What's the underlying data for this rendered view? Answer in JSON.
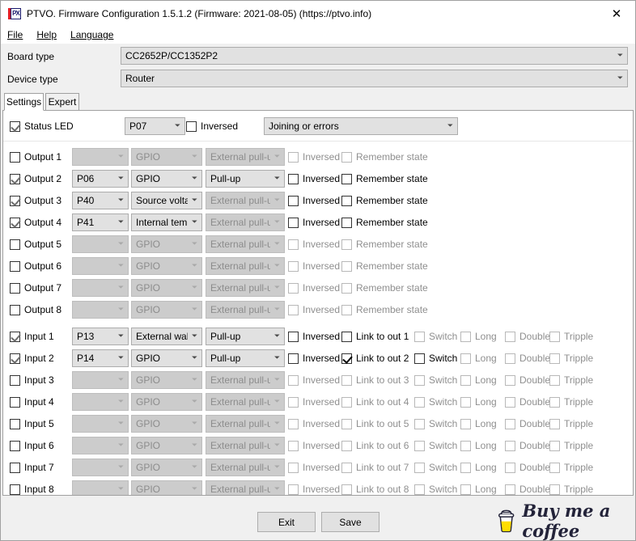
{
  "window": {
    "title": "PTVO. Firmware Configuration 1.5.1.2 (Firmware: 2021-08-05) (https://ptvo.info)",
    "icon": "ptvo-app-icon",
    "close_label": "✕"
  },
  "menu": [
    {
      "label": "File",
      "mnemonic": "F"
    },
    {
      "label": "Help",
      "mnemonic": "H"
    },
    {
      "label": "Language",
      "mnemonic": "L"
    }
  ],
  "top": {
    "board_type_label": "Board type",
    "board_type_value": "CC2652P/CC1352P2",
    "device_type_label": "Device type",
    "device_type_value": "Router"
  },
  "tabs": [
    {
      "label": "Settings",
      "active": true
    },
    {
      "label": "Expert",
      "active": false
    }
  ],
  "status_led": {
    "label": "Status LED",
    "checked": true,
    "pin": "P07",
    "inversed_label": "Inversed",
    "inversed_checked": false,
    "mode": "Joining or errors"
  },
  "labels": {
    "inversed": "Inversed",
    "remember_state": "Remember state",
    "switch": "Switch",
    "long": "Long",
    "double": "Double",
    "tripple": "Tripple"
  },
  "outputs": [
    {
      "label": "Output 1",
      "enabled": false,
      "pin": "",
      "type": "GPIO",
      "pull": "External pull-up",
      "inversed": false,
      "remember": false
    },
    {
      "label": "Output 2",
      "enabled": true,
      "pin": "P06",
      "type": "GPIO",
      "pull": "Pull-up",
      "inversed": false,
      "remember": false
    },
    {
      "label": "Output 3",
      "enabled": true,
      "pin": "P40",
      "type": "Source voltag",
      "pull": "External pull-up",
      "inversed": false,
      "remember": false
    },
    {
      "label": "Output 4",
      "enabled": true,
      "pin": "P41",
      "type": "Internal tempe",
      "pull": "External pull-up",
      "inversed": false,
      "remember": false
    },
    {
      "label": "Output 5",
      "enabled": false,
      "pin": "",
      "type": "GPIO",
      "pull": "External pull-up",
      "inversed": false,
      "remember": false
    },
    {
      "label": "Output 6",
      "enabled": false,
      "pin": "",
      "type": "GPIO",
      "pull": "External pull-up",
      "inversed": false,
      "remember": false
    },
    {
      "label": "Output 7",
      "enabled": false,
      "pin": "",
      "type": "GPIO",
      "pull": "External pull-up",
      "inversed": false,
      "remember": false
    },
    {
      "label": "Output 8",
      "enabled": false,
      "pin": "",
      "type": "GPIO",
      "pull": "External pull-up",
      "inversed": false,
      "remember": false
    }
  ],
  "inputs": [
    {
      "label": "Input 1",
      "enabled": true,
      "pin": "P13",
      "type": "External wake",
      "pull": "Pull-up",
      "inversed": false,
      "link_label": "Link to out 1",
      "link": false,
      "switch": false,
      "long": false,
      "double": false,
      "tripple": false
    },
    {
      "label": "Input 2",
      "enabled": true,
      "pin": "P14",
      "type": "GPIO",
      "pull": "Pull-up",
      "inversed": false,
      "link_label": "Link to out 2",
      "link": true,
      "switch": false,
      "long": false,
      "double": false,
      "tripple": false
    },
    {
      "label": "Input 3",
      "enabled": false,
      "pin": "",
      "type": "GPIO",
      "pull": "External pull-up",
      "inversed": false,
      "link_label": "Link to out 3",
      "link": false,
      "switch": false,
      "long": false,
      "double": false,
      "tripple": false
    },
    {
      "label": "Input 4",
      "enabled": false,
      "pin": "",
      "type": "GPIO",
      "pull": "External pull-up",
      "inversed": false,
      "link_label": "Link to out 4",
      "link": false,
      "switch": false,
      "long": false,
      "double": false,
      "tripple": false
    },
    {
      "label": "Input 5",
      "enabled": false,
      "pin": "",
      "type": "GPIO",
      "pull": "External pull-up",
      "inversed": false,
      "link_label": "Link to out 5",
      "link": false,
      "switch": false,
      "long": false,
      "double": false,
      "tripple": false
    },
    {
      "label": "Input 6",
      "enabled": false,
      "pin": "",
      "type": "GPIO",
      "pull": "External pull-up",
      "inversed": false,
      "link_label": "Link to out 6",
      "link": false,
      "switch": false,
      "long": false,
      "double": false,
      "tripple": false
    },
    {
      "label": "Input 7",
      "enabled": false,
      "pin": "",
      "type": "GPIO",
      "pull": "External pull-up",
      "inversed": false,
      "link_label": "Link to out 7",
      "link": false,
      "switch": false,
      "long": false,
      "double": false,
      "tripple": false
    },
    {
      "label": "Input 8",
      "enabled": false,
      "pin": "",
      "type": "GPIO",
      "pull": "External pull-up",
      "inversed": false,
      "link_label": "Link to out 8",
      "link": false,
      "switch": false,
      "long": false,
      "double": false,
      "tripple": false
    }
  ],
  "footer": {
    "exit_label": "Exit",
    "save_label": "Save",
    "coffee_text": "Buy me a coffee"
  },
  "colors": {
    "coffee_yellow": "#FFDD00",
    "coffee_outline": "#232339",
    "icon_red": "#E01B24",
    "window_bg": "#F0F0F0",
    "panel_bg": "#FFFFFF",
    "combo_bg": "#E1E1E1",
    "combo_disabled_bg": "#CCCCCC"
  }
}
